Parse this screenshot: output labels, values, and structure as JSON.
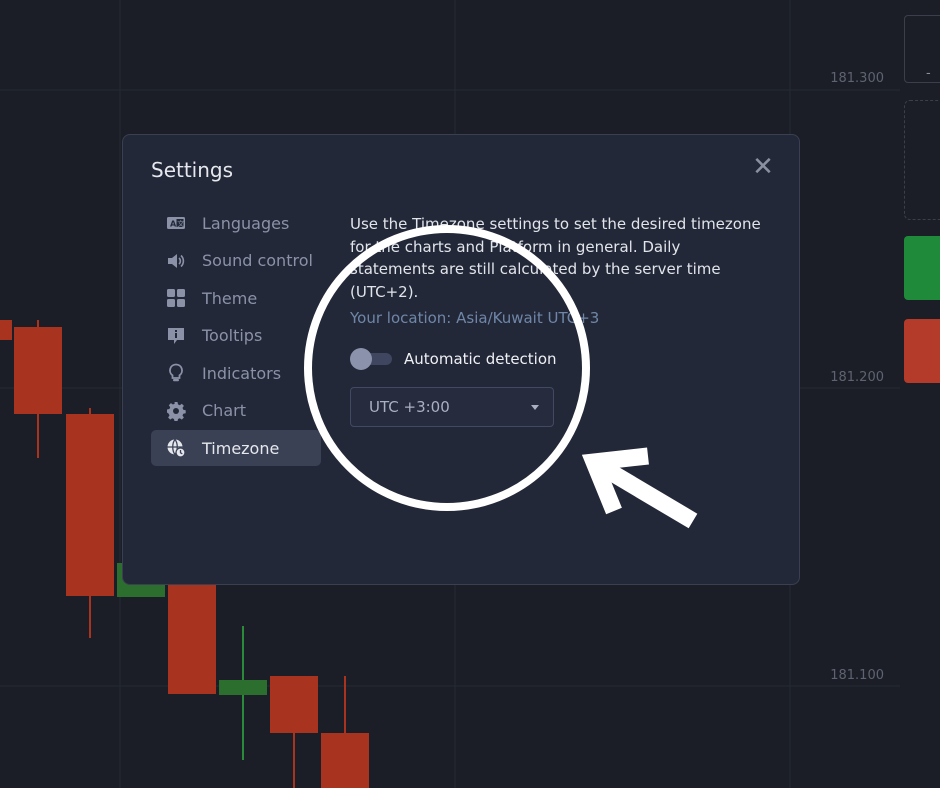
{
  "chart_background": {
    "price_labels": [
      "181.300",
      "181.200",
      "181.100"
    ],
    "colors": {
      "up": "#1f8a3a",
      "down": "#b43a2a",
      "grid": "#2a2e38"
    }
  },
  "right_panel": {
    "minus_label": "-"
  },
  "settings": {
    "title": "Settings",
    "close_icon": "close-icon",
    "menu": [
      {
        "label": "Languages",
        "icon": "language-icon"
      },
      {
        "label": "Sound control",
        "icon": "speaker-icon"
      },
      {
        "label": "Theme",
        "icon": "theme-grid-icon"
      },
      {
        "label": "Tooltips",
        "icon": "info-icon"
      },
      {
        "label": "Indicators",
        "icon": "lightbulb-icon"
      },
      {
        "label": "Chart",
        "icon": "gear-icon"
      },
      {
        "label": "Timezone",
        "icon": "globe-clock-icon",
        "active": true
      }
    ],
    "timezone": {
      "description": "Use the Timezone settings to set the desired timezone for the charts and Platform in general. Daily statements are still calculated by the server time (UTC+2).",
      "location": "Your location: Asia/Kuwait UTC+3",
      "auto_detect_label": "Automatic detection",
      "auto_detect_enabled": false,
      "selected": "UTC +3:00"
    }
  }
}
